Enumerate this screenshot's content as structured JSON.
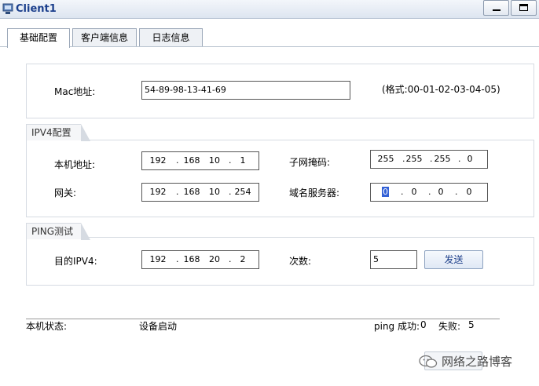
{
  "window": {
    "title": "Client1"
  },
  "tabs": [
    {
      "label": "基础配置",
      "active": true
    },
    {
      "label": "客户端信息",
      "active": false
    },
    {
      "label": "日志信息",
      "active": false
    }
  ],
  "mac": {
    "label": "Mac地址:",
    "value": "54-89-98-13-41-69",
    "format_hint": "(格式:00-01-02-03-04-05)"
  },
  "ipv4": {
    "legend": "IPV4配置",
    "local_ip_label": "本机地址:",
    "local_ip": [
      "192",
      "168",
      "10",
      "1"
    ],
    "mask_label": "子网掩码:",
    "mask": [
      "255",
      "255",
      "255",
      "0"
    ],
    "gateway_label": "网关:",
    "gateway": [
      "192",
      "168",
      "10",
      "254"
    ],
    "dns_label": "域名服务器:",
    "dns": [
      "0",
      "0",
      "0",
      "0"
    ]
  },
  "ping": {
    "legend": "PING测试",
    "target_label": "目的IPV4:",
    "target": [
      "192",
      "168",
      "20",
      "2"
    ],
    "count_label": "次数:",
    "count": "5",
    "send_label": "发送"
  },
  "status": {
    "label": "本机状态:",
    "value": "设备启动",
    "ping_success_label": "ping 成功:",
    "ping_success": "0",
    "fail_label": "失败:",
    "fail": "5"
  },
  "watermark": "网络之路博客",
  "colors": {
    "title_text": "#1a3e8c",
    "selection": "#3361d6",
    "button_text": "#1d3f8a"
  }
}
